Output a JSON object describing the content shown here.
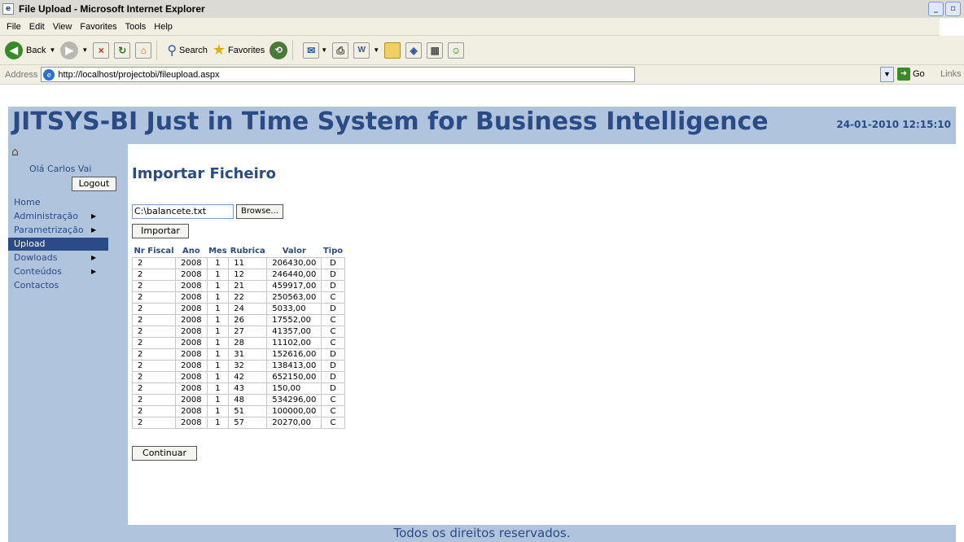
{
  "window": {
    "title": "File Upload - Microsoft Internet Explorer"
  },
  "menu": [
    "File",
    "Edit",
    "View",
    "Favorites",
    "Tools",
    "Help"
  ],
  "toolbar": {
    "back": "Back",
    "search": "Search",
    "favorites": "Favorites"
  },
  "address": {
    "label": "Address",
    "url": "http://localhost/projectobi/fileupload.aspx",
    "go": "Go",
    "links": "Links"
  },
  "header": {
    "title": "JITSYS-BI Just in Time System for Business Intelligence",
    "datetime": "24-01-2010 12:15:10"
  },
  "sidebar": {
    "greeting": "Olá Carlos Vai",
    "logout": "Logout",
    "items": [
      {
        "label": "Home",
        "arrow": false,
        "active": false
      },
      {
        "label": "Administração",
        "arrow": true,
        "active": false
      },
      {
        "label": "Parametrização",
        "arrow": true,
        "active": false
      },
      {
        "label": "Upload",
        "arrow": false,
        "active": true
      },
      {
        "label": "Dowloads",
        "arrow": true,
        "active": false
      },
      {
        "label": "Conteúdos",
        "arrow": true,
        "active": false
      },
      {
        "label": "Contactos",
        "arrow": false,
        "active": false
      }
    ]
  },
  "main": {
    "page_title": "Importar Ficheiro",
    "file_value": "C:\\balancete.txt",
    "browse": "Browse...",
    "import_button": "Importar",
    "continue_button": "Continuar",
    "table": {
      "columns": [
        "Nr Fiscal",
        "Ano",
        "Mes",
        "Rubrica",
        "Valor",
        "Tipo"
      ],
      "rows": [
        [
          "2",
          "2008",
          "1",
          "11",
          "206430,00",
          "D"
        ],
        [
          "2",
          "2008",
          "1",
          "12",
          "246440,00",
          "D"
        ],
        [
          "2",
          "2008",
          "1",
          "21",
          "459917,00",
          "D"
        ],
        [
          "2",
          "2008",
          "1",
          "22",
          "250563,00",
          "C"
        ],
        [
          "2",
          "2008",
          "1",
          "24",
          "5033,00",
          "D"
        ],
        [
          "2",
          "2008",
          "1",
          "26",
          "17552,00",
          "C"
        ],
        [
          "2",
          "2008",
          "1",
          "27",
          "41357,00",
          "C"
        ],
        [
          "2",
          "2008",
          "1",
          "28",
          "11102,00",
          "C"
        ],
        [
          "2",
          "2008",
          "1",
          "31",
          "152616,00",
          "D"
        ],
        [
          "2",
          "2008",
          "1",
          "32",
          "138413,00",
          "D"
        ],
        [
          "2",
          "2008",
          "1",
          "42",
          "652150,00",
          "D"
        ],
        [
          "2",
          "2008",
          "1",
          "43",
          "150,00",
          "D"
        ],
        [
          "2",
          "2008",
          "1",
          "48",
          "534296,00",
          "C"
        ],
        [
          "2",
          "2008",
          "1",
          "51",
          "100000,00",
          "C"
        ],
        [
          "2",
          "2008",
          "1",
          "57",
          "20270,00",
          "C"
        ]
      ]
    }
  },
  "footer": "Todos os direitos reservados.",
  "colors": {
    "brand": "#2a4b85",
    "panel": "#b0c4de"
  }
}
